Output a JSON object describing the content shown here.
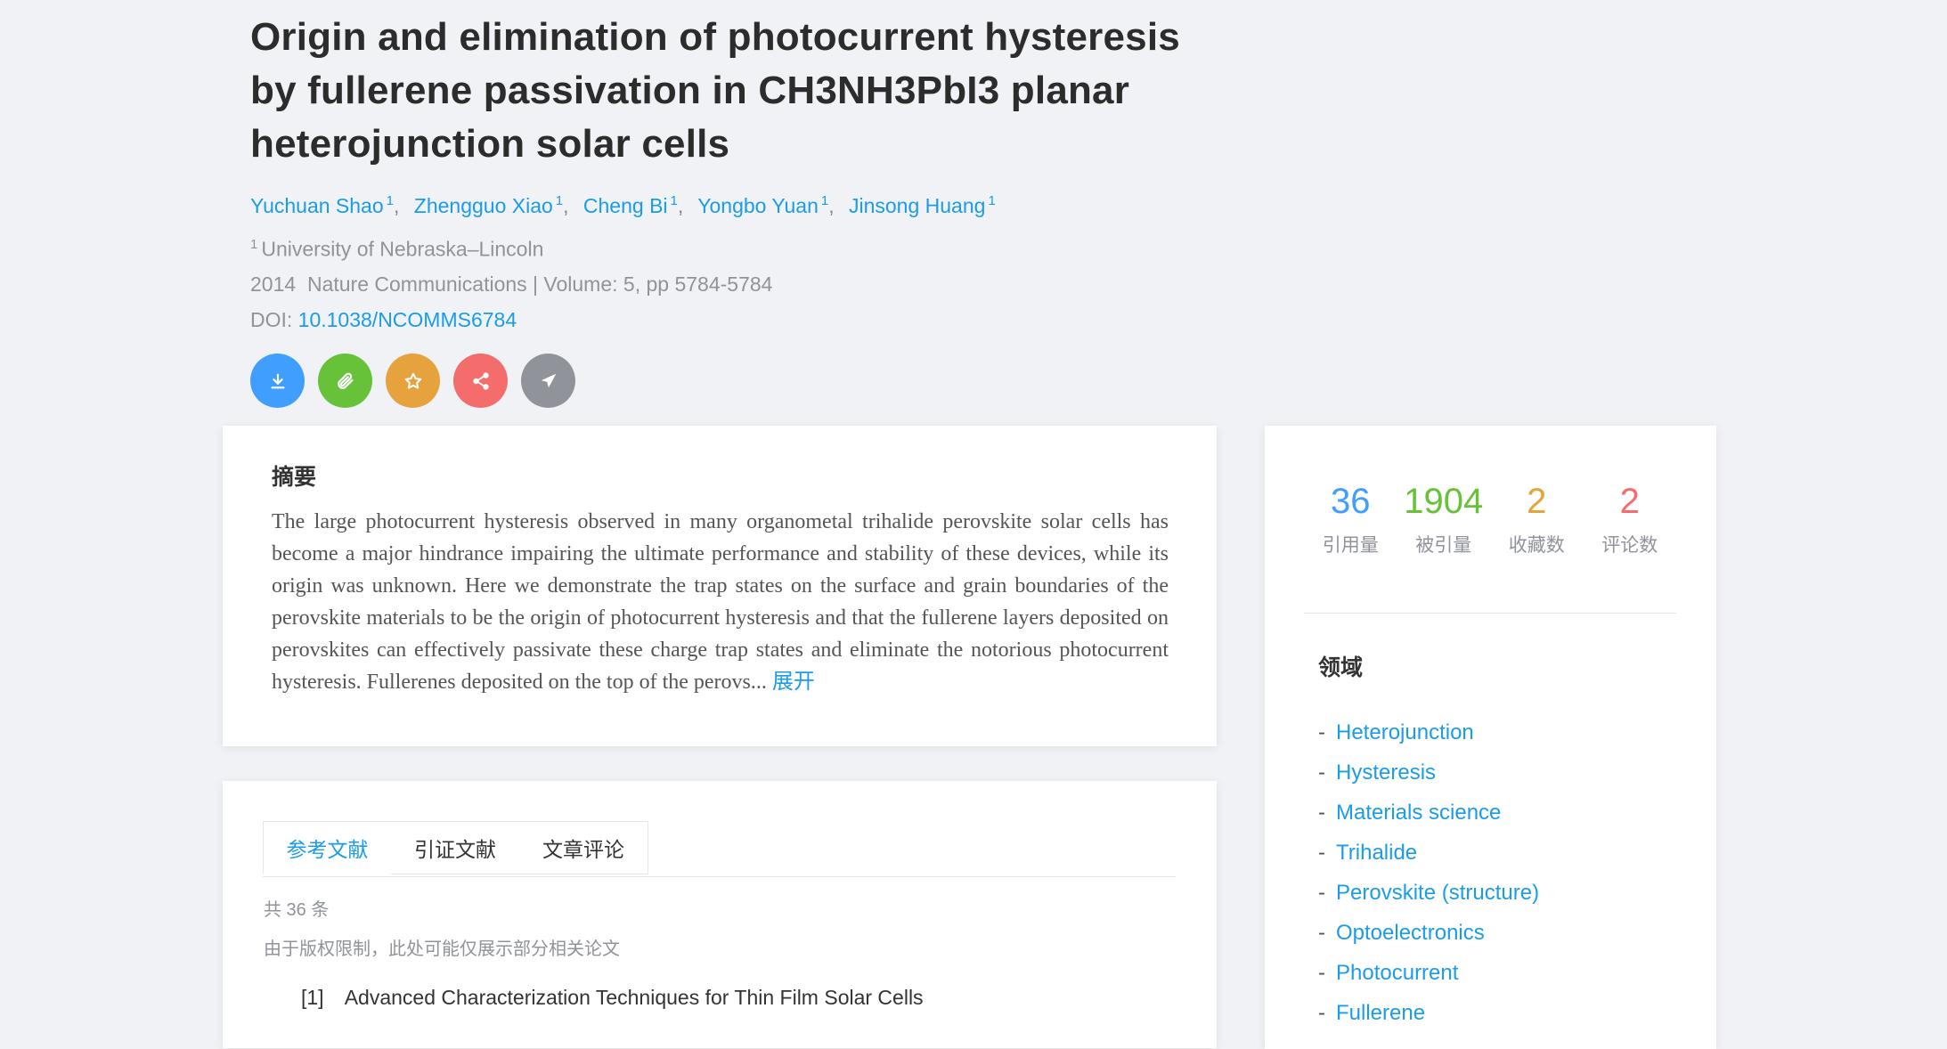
{
  "paper": {
    "title": "Origin and elimination of photocurrent hysteresis by fullerene passivation in CH3NH3PbI3 planar heterojunction solar cells",
    "authors": [
      {
        "name": "Yuchuan Shao",
        "affil": "1"
      },
      {
        "name": "Zhengguo Xiao",
        "affil": "1"
      },
      {
        "name": "Cheng Bi",
        "affil": "1"
      },
      {
        "name": "Yongbo Yuan",
        "affil": "1"
      },
      {
        "name": "Jinsong Huang",
        "affil": "1"
      }
    ],
    "affiliation_num": "1",
    "affiliation": "University of Nebraska–Lincoln",
    "year": "2014",
    "journal_line": "Nature Communications | Volume: 5, pp 5784-5784",
    "doi_label": "DOI:",
    "doi": "10.1038/NCOMMS6784"
  },
  "actions": [
    {
      "name": "download-icon",
      "color": "#409eff"
    },
    {
      "name": "attachment-icon",
      "color": "#67c23a"
    },
    {
      "name": "star-icon",
      "color": "#e6a23c"
    },
    {
      "name": "share-icon",
      "color": "#f56c6c"
    },
    {
      "name": "send-icon",
      "color": "#909399"
    }
  ],
  "abstract": {
    "title": "摘要",
    "text": "The large photocurrent hysteresis observed in many organometal trihalide perovskite solar cells has become a major hindrance impairing the ultimate performance and stability of these devices, while its origin was unknown. Here we demonstrate the trap states on the surface and grain boundaries of the perovskite materials to be the origin of photocurrent hysteresis and that the fullerene layers deposited on perovskites can effectively passivate these charge trap states and eliminate the notorious photocurrent hysteresis. Fullerenes deposited on the top of the perovs...",
    "expand": "展开"
  },
  "tabs": [
    {
      "label": "参考文献",
      "active": true
    },
    {
      "label": "引证文献",
      "active": false
    },
    {
      "label": "文章评论",
      "active": false
    }
  ],
  "refs": {
    "count": "共 36 条",
    "note": "由于版权限制，此处可能仅展示部分相关论文",
    "items": [
      {
        "num": "[1]",
        "title": "Advanced Characterization Techniques for Thin Film Solar Cells"
      }
    ]
  },
  "stats": [
    {
      "value": "36",
      "label": "引用量",
      "color": "#409eff"
    },
    {
      "value": "1904",
      "label": "被引量",
      "color": "#67c23a"
    },
    {
      "value": "2",
      "label": "收藏数",
      "color": "#e6a23c"
    },
    {
      "value": "2",
      "label": "评论数",
      "color": "#f56c6c"
    }
  ],
  "fields": {
    "title": "领域",
    "items": [
      "Heterojunction",
      "Hysteresis",
      "Materials science",
      "Trihalide",
      "Perovskite (structure)",
      "Optoelectronics",
      "Photocurrent",
      "Fullerene"
    ]
  }
}
